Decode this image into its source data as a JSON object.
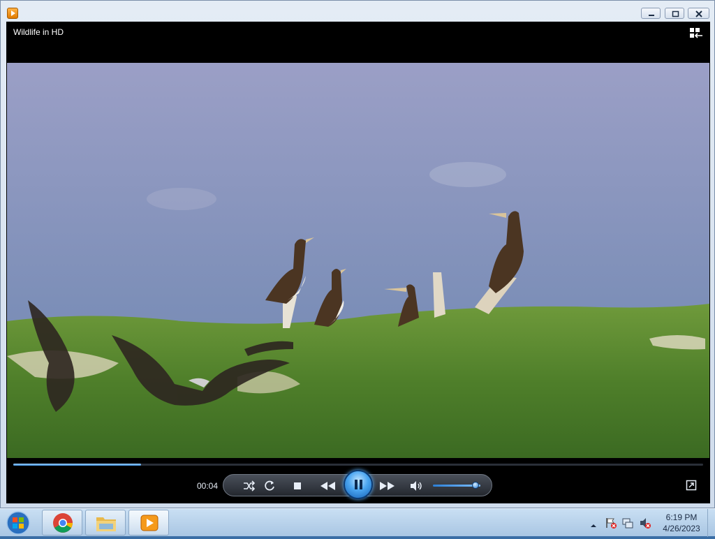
{
  "window": {
    "title": "Wildlife in HD",
    "icons": {
      "app": "windows-media-player-icon",
      "minimize": "minimize-icon",
      "maximize": "maximize-icon",
      "close": "close-icon",
      "switch_to_library": "switch-to-library-icon"
    }
  },
  "player": {
    "elapsed": "00:04",
    "progress_fraction": 0.185,
    "volume_fraction": 0.9,
    "controls": [
      "shuffle-icon",
      "repeat-icon",
      "stop-icon",
      "previous-icon",
      "play-icon",
      "next-icon",
      "volume-icon",
      "fullscreen-icon"
    ],
    "colors": {
      "accent": "#3b8de0",
      "background": "#000000"
    }
  },
  "video_frame": {
    "description_icon": "video-frame-birds"
  },
  "taskbar": {
    "clock_time": "6:19 PM",
    "clock_date": "4/26/2023",
    "pinned": [
      "chrome-icon",
      "file-explorer-icon",
      "windows-media-player-icon"
    ],
    "tray": [
      "show-hidden-icons-arrow",
      "action-center-flag-icon",
      "network-icon",
      "volume-muted-icon"
    ]
  }
}
